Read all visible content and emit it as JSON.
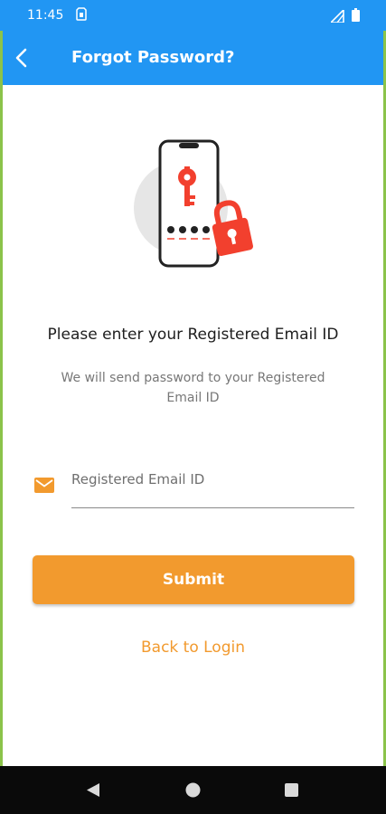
{
  "status_bar": {
    "time": "11:45",
    "icons": [
      "sim-card-icon",
      "signal-icon",
      "battery-icon"
    ]
  },
  "app_bar": {
    "title": "Forgot Password?",
    "back_icon": "chevron-left-icon"
  },
  "illustration": {
    "icon": "phone-key-lock-icon"
  },
  "content": {
    "heading": "Please enter your Registered Email ID",
    "subtext": "We will send password to your Registered Email ID"
  },
  "form": {
    "email_icon": "mail-icon",
    "email_placeholder": "Registered Email ID",
    "email_value": "",
    "submit_label": "Submit"
  },
  "links": {
    "back_to_login": "Back to Login"
  },
  "nav_bar": {
    "icons": [
      "nav-back-icon",
      "nav-home-icon",
      "nav-recents-icon"
    ]
  },
  "colors": {
    "primary": "#2196f3",
    "accent": "#f29a2e",
    "illustration_red": "#f2402e"
  }
}
